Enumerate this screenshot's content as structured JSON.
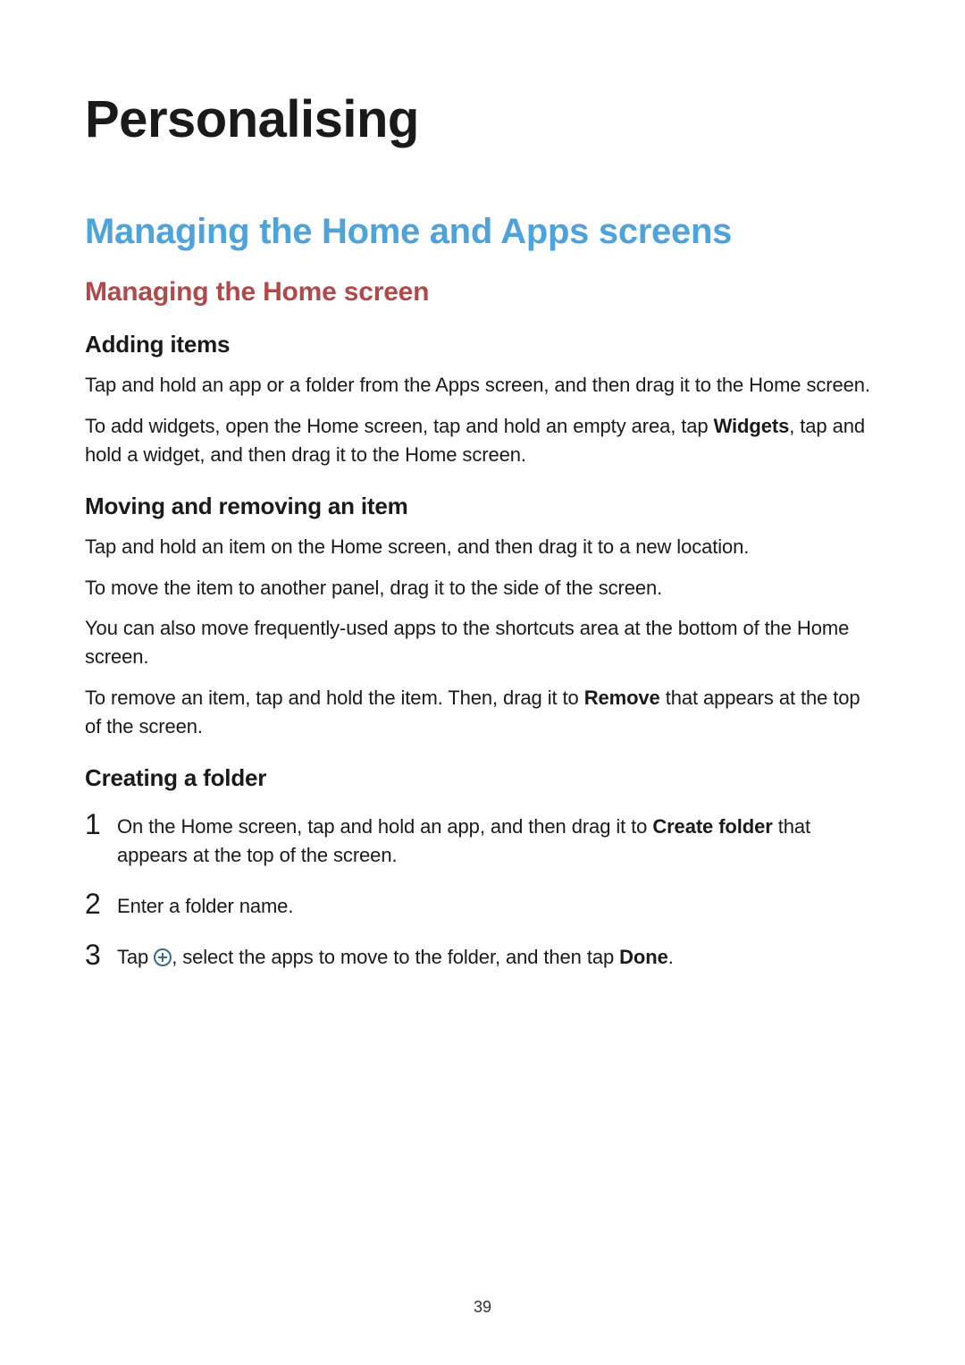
{
  "page_number": "39",
  "h1": "Personalising",
  "h2": "Managing the Home and Apps screens",
  "h3": "Managing the Home screen",
  "sec1": {
    "title": "Adding items",
    "p1a": "Tap and hold an app or a folder from the Apps screen, and then drag it to the Home screen.",
    "p2a": "To add widgets, open the Home screen, tap and hold an empty area, tap ",
    "p2b": "Widgets",
    "p2c": ", tap and hold a widget, and then drag it to the Home screen."
  },
  "sec2": {
    "title": "Moving and removing an item",
    "p1": "Tap and hold an item on the Home screen, and then drag it to a new location.",
    "p2": "To move the item to another panel, drag it to the side of the screen.",
    "p3": "You can also move frequently-used apps to the shortcuts area at the bottom of the Home screen.",
    "p4a": "To remove an item, tap and hold the item. Then, drag it to ",
    "p4b": "Remove",
    "p4c": " that appears at the top of the screen."
  },
  "sec3": {
    "title": "Creating a folder",
    "steps": {
      "n1": "1",
      "s1a": "On the Home screen, tap and hold an app, and then drag it to ",
      "s1b": "Create folder",
      "s1c": " that appears at the top of the screen.",
      "n2": "2",
      "s2": "Enter a folder name.",
      "n3": "3",
      "s3a": "Tap ",
      "s3b": ", select the apps to move to the folder, and then tap ",
      "s3c": "Done",
      "s3d": "."
    }
  }
}
